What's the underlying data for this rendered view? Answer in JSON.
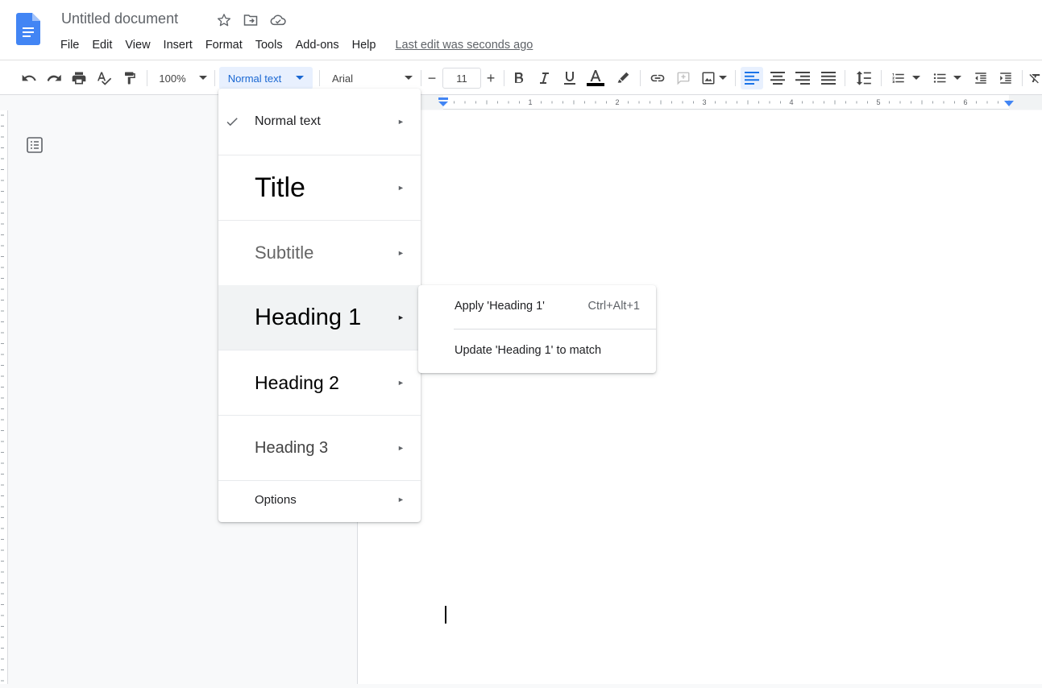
{
  "header": {
    "title": "Untitled document",
    "menus": [
      "File",
      "Edit",
      "View",
      "Insert",
      "Format",
      "Tools",
      "Add-ons",
      "Help"
    ],
    "last_edit": "Last edit was seconds ago"
  },
  "toolbar": {
    "zoom": "100%",
    "style": "Normal text",
    "font": "Arial",
    "font_size": "11",
    "minus": "−",
    "plus": "+"
  },
  "ruler": {
    "marks": [
      "1",
      "2",
      "3",
      "4",
      "5",
      "6"
    ]
  },
  "style_menu": {
    "items": [
      {
        "label": "Normal text",
        "checked": true
      },
      {
        "label": "Title"
      },
      {
        "label": "Subtitle"
      },
      {
        "label": "Heading 1",
        "highlighted": true
      },
      {
        "label": "Heading 2"
      },
      {
        "label": "Heading 3"
      },
      {
        "label": "Options"
      }
    ]
  },
  "submenu": {
    "apply_label": "Apply 'Heading 1'",
    "apply_shortcut": "Ctrl+Alt+1",
    "update_label": "Update 'Heading 1' to match"
  },
  "colors": {
    "accent": "#1a73e8",
    "docs_blue": "#4285f4",
    "highlight": "#e8f0fe"
  }
}
